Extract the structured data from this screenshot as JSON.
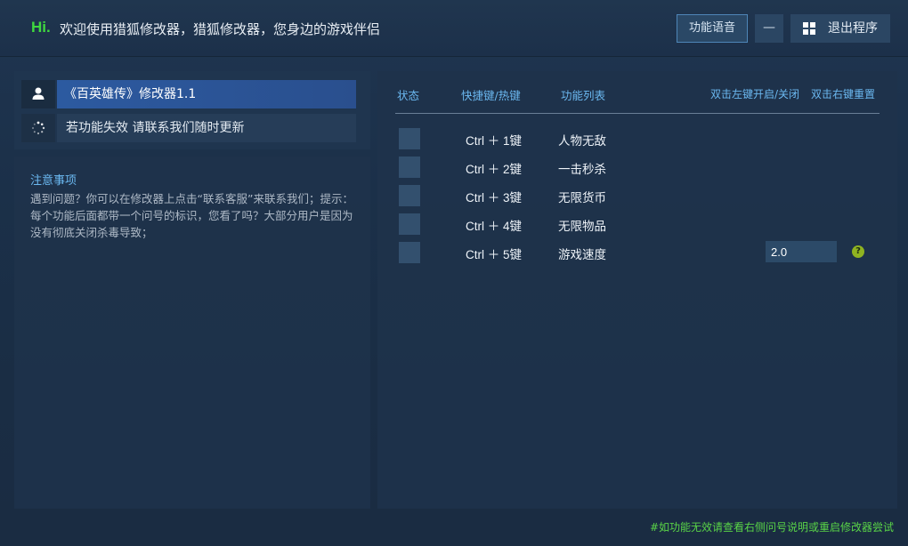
{
  "titlebar": {
    "hi": "Hi.",
    "welcome": "欢迎使用猎狐修改器，猎狐修改器，您身边的游戏伴侣",
    "voice_button": "功能语音",
    "minimize_button": "—",
    "exit_button": "退出程序"
  },
  "left": {
    "game_title": "《百英雄传》修改器1.1",
    "notice": "若功能失效  请联系我们随时更新",
    "notes_title": "注意事项",
    "notes_body": "遇到问题？你可以在修改器上点击“联系客服”来联系我们；提示：每个功能后面都带一个问号的标识，您看了吗？大部分用户是因为没有彻底关闭杀毒导致；"
  },
  "table": {
    "headers": {
      "status": "状态",
      "hotkey": "快捷键/热键",
      "functions": "功能列表",
      "left_click_hint": "双击左键开启/关闭",
      "right_click_hint": "双击右键重置"
    },
    "rows": [
      {
        "hotkey": "Ctrl ＋ 1键",
        "function": "人物无敌"
      },
      {
        "hotkey": "Ctrl ＋ 2键",
        "function": "一击秒杀"
      },
      {
        "hotkey": "Ctrl ＋ 3键",
        "function": "无限货币"
      },
      {
        "hotkey": "Ctrl ＋ 4键",
        "function": "无限物品"
      },
      {
        "hotkey": "Ctrl ＋ 5键",
        "function": "游戏速度",
        "input_value": "2.0",
        "help": "?"
      }
    ]
  },
  "footer": {
    "note": "#如功能无效请查看右侧问号说明或重启修改器尝试"
  },
  "colors": {
    "accent_blue": "#6bb8f0",
    "hi_green": "#3fd93f",
    "footer_green": "#59d447",
    "selected_row": "#2c5aa0"
  }
}
